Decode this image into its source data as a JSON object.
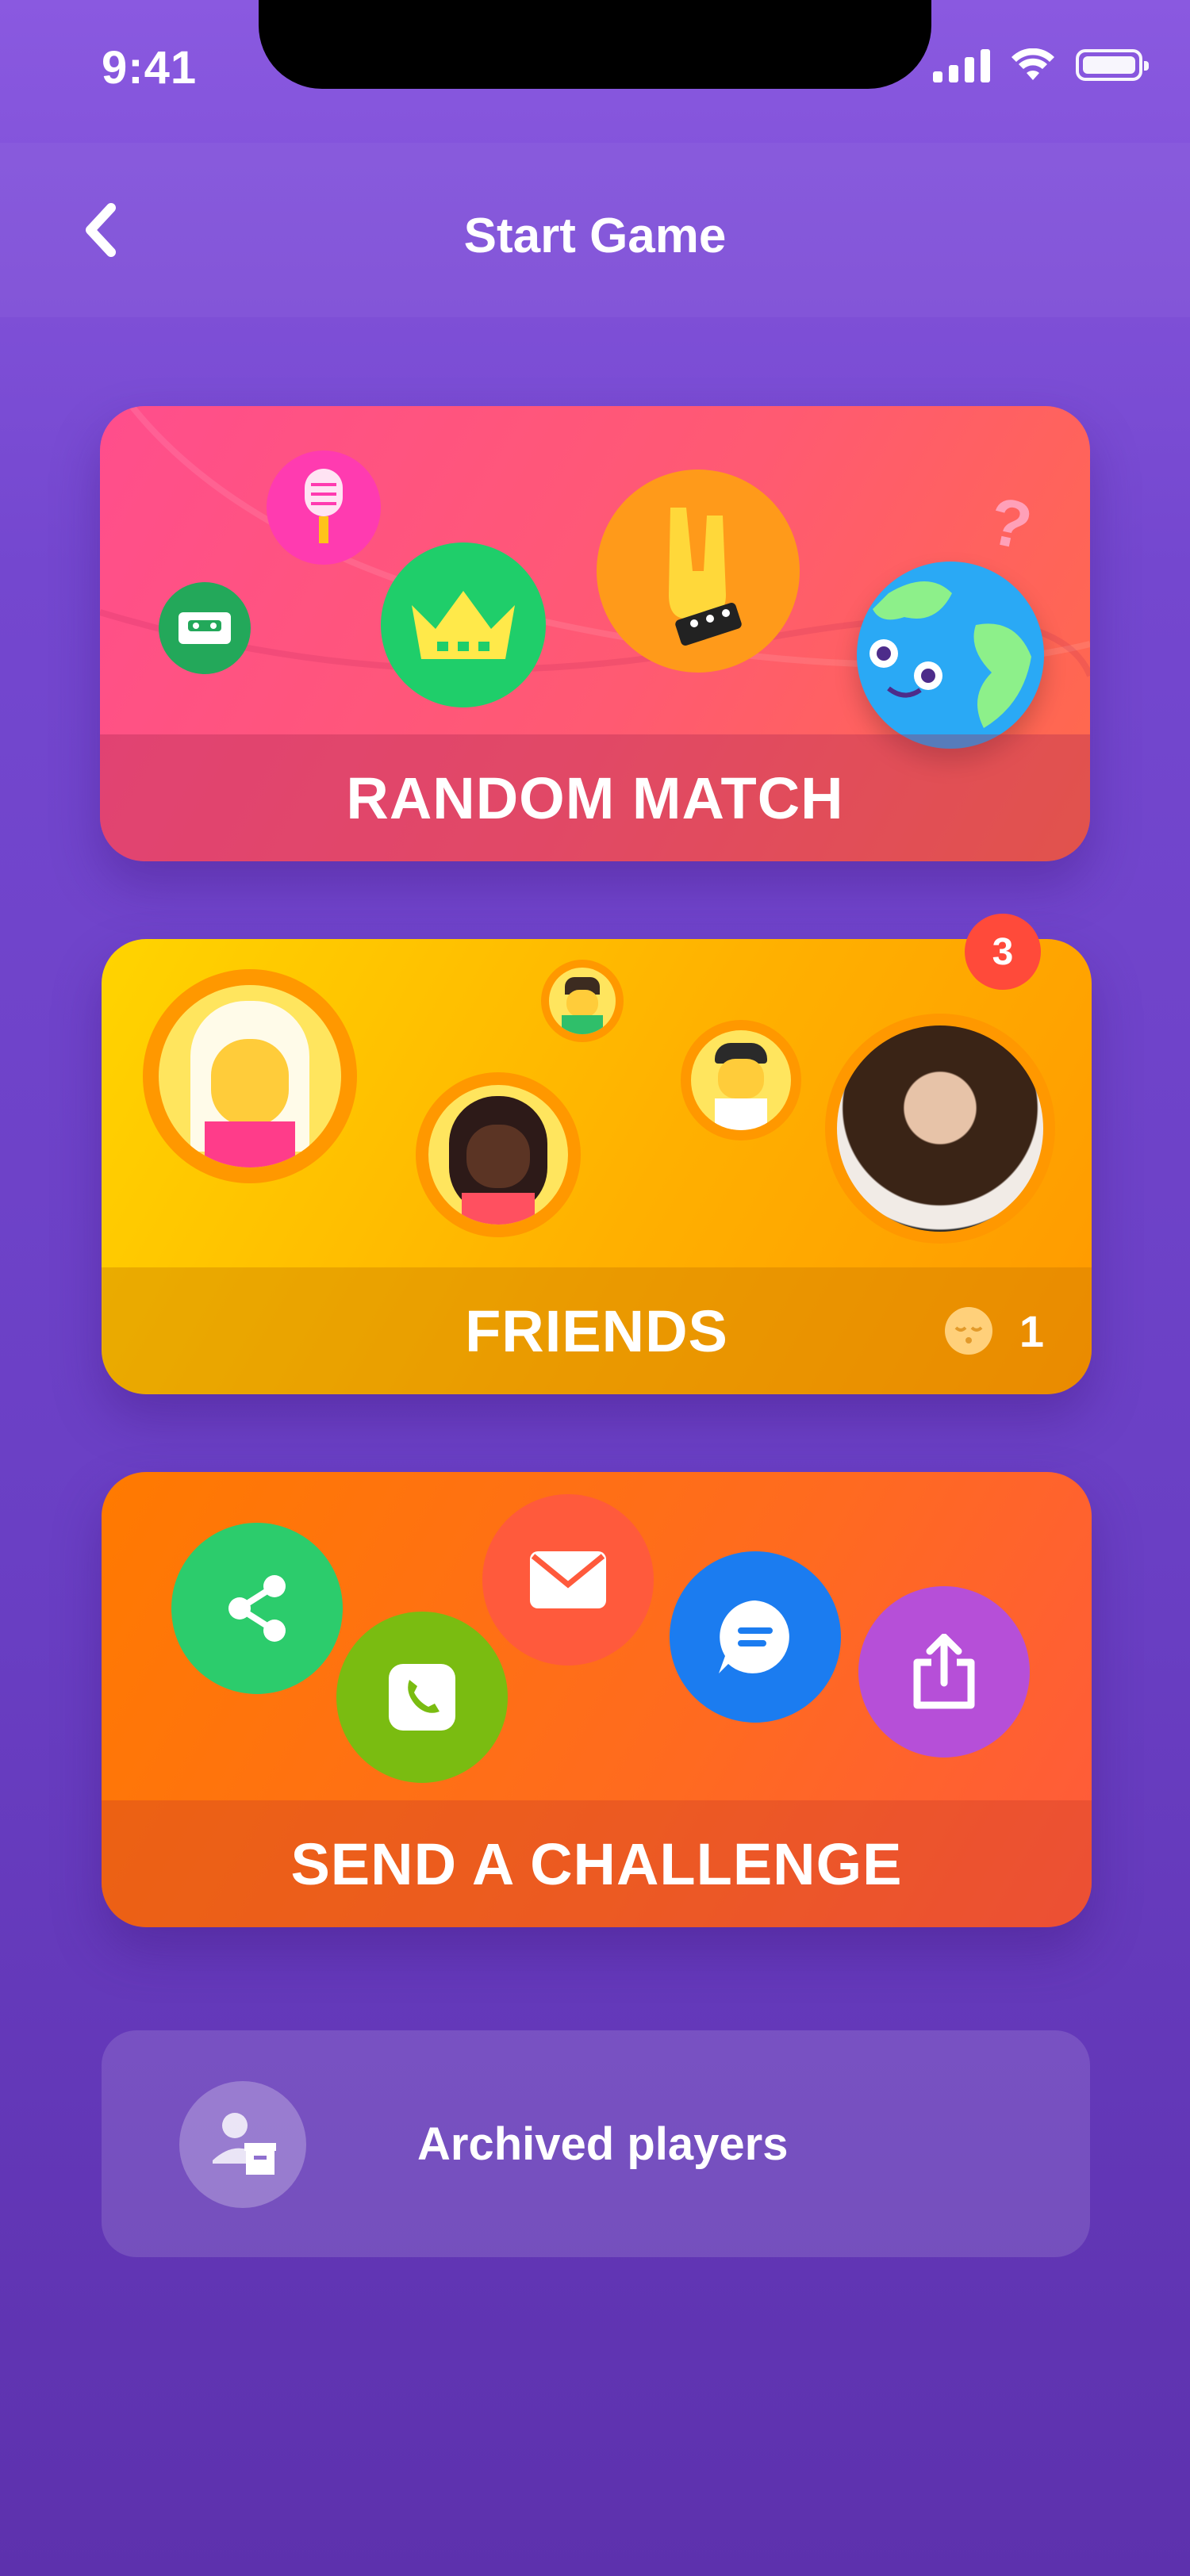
{
  "status_bar": {
    "time": "9:41"
  },
  "header": {
    "title": "Start Game"
  },
  "options": {
    "random_match": {
      "label": "RANDOM MATCH"
    },
    "friends": {
      "label": "FRIENDS",
      "badge": "3",
      "waiting_count": "1"
    },
    "challenge": {
      "label": "SEND A CHALLENGE"
    }
  },
  "archived": {
    "label": "Archived players"
  },
  "colors": {
    "background": "#7447cf",
    "random": "#ff5a72",
    "friends": "#ffb000",
    "challenge": "#ff6a20",
    "badge": "#ff4a3a"
  },
  "icons": {
    "random_match": [
      "cassette-icon",
      "microphone-icon",
      "crown-icon",
      "rock-hand-icon",
      "globe-character-icon",
      "question-mark-icon"
    ],
    "friends": [
      "friend-avatar-blonde",
      "friend-avatar-boy-guitar",
      "friend-avatar-dark-hair",
      "friend-avatar-punk",
      "friend-avatar-photo",
      "sleeping-face-icon"
    ],
    "challenge": [
      "share-icon",
      "phone-icon",
      "mail-icon",
      "message-icon",
      "export-icon"
    ]
  }
}
